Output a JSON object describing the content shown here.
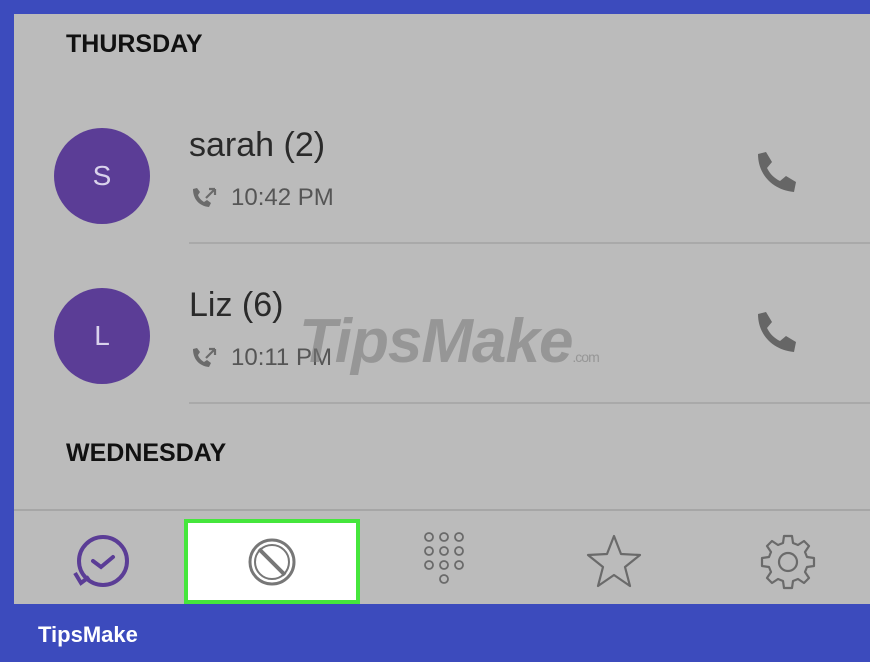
{
  "sections": [
    {
      "day": "THURSDAY",
      "calls": [
        {
          "initial": "S",
          "name": "sarah (2)",
          "time": "10:42 PM",
          "type_icon": "missed-call-icon",
          "action_icon": "phone-icon"
        },
        {
          "initial": "L",
          "name": "Liz (6)",
          "time": "10:11 PM",
          "type_icon": "missed-call-icon",
          "action_icon": "phone-icon"
        }
      ]
    },
    {
      "day": "WEDNESDAY",
      "calls": []
    }
  ],
  "tabs": [
    {
      "name": "Recents",
      "icon": "recents-icon",
      "selected": false
    },
    {
      "name": "Blocked",
      "icon": "block-icon",
      "selected": true
    },
    {
      "name": "Dialpad",
      "icon": "dialpad-icon",
      "selected": false
    },
    {
      "name": "Favorites",
      "icon": "star-icon",
      "selected": false
    },
    {
      "name": "Settings",
      "icon": "gear-icon",
      "selected": false
    }
  ],
  "watermark": {
    "text": "TipsMake",
    "suffix": ".com"
  },
  "footer": {
    "brand": "TipsMake"
  },
  "colors": {
    "frame": "#3c4bbd",
    "background": "#bbbbbb",
    "avatar": "#5b3d96",
    "selected_tab_border": "#45e63c",
    "icon_gray": "#666666"
  }
}
